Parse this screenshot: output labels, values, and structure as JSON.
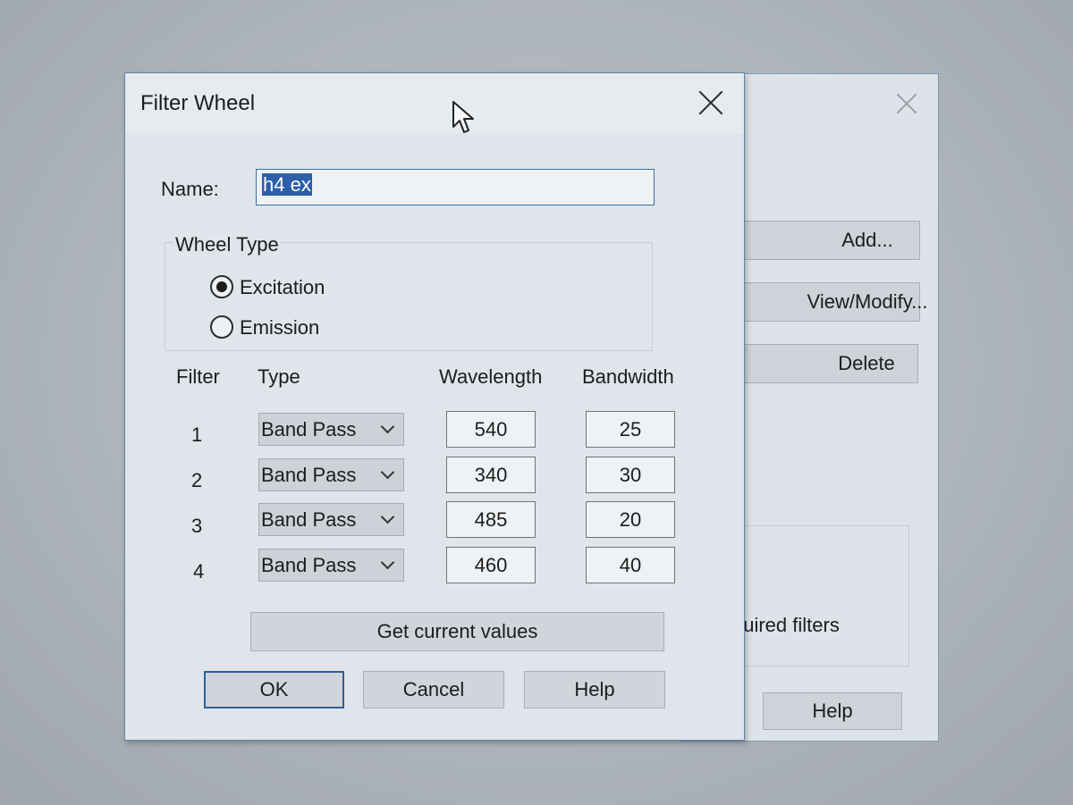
{
  "background_dialog": {
    "buttons": {
      "add": "Add...",
      "view_modify": "View/Modify...",
      "delete": "Delete",
      "help": "Help"
    },
    "group_text": "quired filters"
  },
  "dialog": {
    "title": "Filter Wheel",
    "name_label": "Name:",
    "name_value": "h4 ex",
    "wheel_type": {
      "label": "Wheel Type",
      "options": [
        {
          "label": "Excitation",
          "checked": true
        },
        {
          "label": "Emission",
          "checked": false
        }
      ]
    },
    "table": {
      "headers": {
        "filter": "Filter",
        "type": "Type",
        "wavelength": "Wavelength",
        "bandwidth": "Bandwidth"
      },
      "rows": [
        {
          "filter": "1",
          "type": "Band Pass",
          "wavelength": "540",
          "bandwidth": "25"
        },
        {
          "filter": "2",
          "type": "Band Pass",
          "wavelength": "340",
          "bandwidth": "30"
        },
        {
          "filter": "3",
          "type": "Band Pass",
          "wavelength": "485",
          "bandwidth": "20"
        },
        {
          "filter": "4",
          "type": "Band Pass",
          "wavelength": "460",
          "bandwidth": "40"
        }
      ]
    },
    "buttons": {
      "get_current": "Get current values",
      "ok": "OK",
      "cancel": "Cancel",
      "help": "Help"
    }
  },
  "colors": {
    "dialog_border": "#5f84ab",
    "selection": "#2d5faa",
    "default_button_border": "#2f5f97"
  }
}
